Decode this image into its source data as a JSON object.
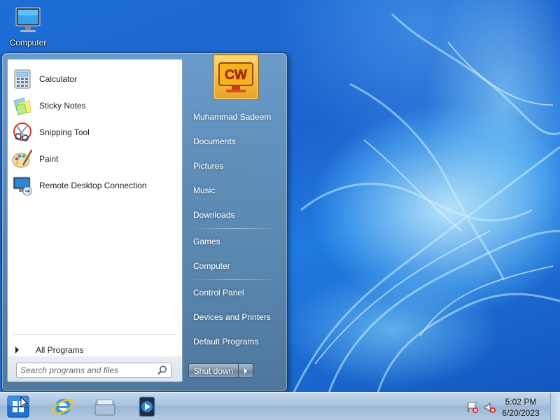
{
  "desktop": {
    "icons": [
      {
        "label": "Computer",
        "icon": "computer-icon"
      }
    ]
  },
  "start_menu": {
    "pinned_programs": [
      {
        "label": "Calculator",
        "icon": "calculator-icon"
      },
      {
        "label": "Sticky Notes",
        "icon": "sticky-notes-icon"
      },
      {
        "label": "Snipping Tool",
        "icon": "snipping-tool-icon"
      },
      {
        "label": "Paint",
        "icon": "paint-icon"
      },
      {
        "label": "Remote Desktop Connection",
        "icon": "remote-desktop-icon"
      }
    ],
    "all_programs_label": "All Programs",
    "search_placeholder": "Search programs and files",
    "user_picture_text": "CW",
    "right_links": [
      {
        "label": "Muhammad Sadeem"
      },
      {
        "label": "Documents"
      },
      {
        "label": "Pictures"
      },
      {
        "label": "Music"
      },
      {
        "label": "Downloads"
      },
      {
        "label": "Games"
      },
      {
        "label": "Computer"
      },
      {
        "label": "Control Panel"
      },
      {
        "label": "Devices and Printers"
      },
      {
        "label": "Default Programs"
      }
    ],
    "shutdown_label": "Shut down"
  },
  "taskbar": {
    "pinned": [
      {
        "icon": "internet-explorer-icon"
      },
      {
        "icon": "windows-explorer-icon"
      },
      {
        "icon": "media-player-icon"
      }
    ],
    "tray": [
      {
        "icon": "action-center-icon"
      },
      {
        "icon": "volume-muted-icon"
      }
    ],
    "clock_time": "5:02 PM",
    "clock_date": "6/20/2023"
  },
  "colors": {
    "desktop_blue": "#1d63cf",
    "start_orb": "#1f74d9",
    "menu_text_right": "#ffffff"
  }
}
